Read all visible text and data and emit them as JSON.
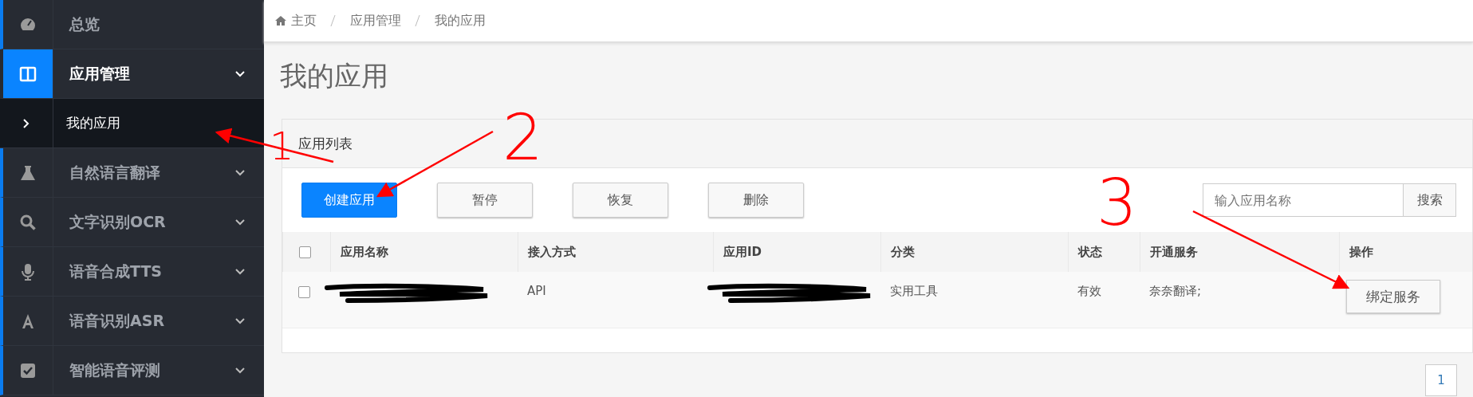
{
  "sidebar": {
    "items": [
      {
        "label": "总览",
        "selected": false,
        "has_caret": false
      },
      {
        "label": "应用管理",
        "selected": true,
        "has_caret": true,
        "expanded": true,
        "children": [
          {
            "label": "我的应用",
            "selected": true
          }
        ]
      },
      {
        "label": "自然语言翻译",
        "selected": false,
        "has_caret": true
      },
      {
        "label": "文字识别OCR",
        "selected": false,
        "has_caret": true
      },
      {
        "label": "语音合成TTS",
        "selected": false,
        "has_caret": true
      },
      {
        "label": "语音识别ASR",
        "selected": false,
        "has_caret": true
      },
      {
        "label": "智能语音评测",
        "selected": false,
        "has_caret": true
      }
    ]
  },
  "breadcrumb": [
    "主页",
    "应用管理",
    "我的应用"
  ],
  "page_title": "我的应用",
  "panel": {
    "title": "应用列表",
    "toolbar": [
      {
        "label": "创建应用",
        "kind": "primary"
      },
      {
        "label": "暂停",
        "kind": "default"
      },
      {
        "label": "恢复",
        "kind": "default"
      },
      {
        "label": "删除",
        "kind": "default"
      }
    ],
    "search": {
      "placeholder": "输入应用名称",
      "button": "搜索"
    },
    "table": {
      "columns": [
        "应用名称",
        "接入方式",
        "应用ID",
        "分类",
        "状态",
        "开通服务",
        "操作"
      ],
      "header_checked": false,
      "rows": [
        {
          "checked": false,
          "cells": [
            {
              "kind": "redacted"
            },
            {
              "kind": "text",
              "text": "API"
            },
            {
              "kind": "redacted"
            },
            {
              "kind": "text",
              "text": "实用工具"
            },
            {
              "kind": "text",
              "text": "有效"
            },
            {
              "kind": "text",
              "text": "奈奈翻译;"
            },
            {
              "kind": "button",
              "text": "绑定服务"
            }
          ]
        }
      ]
    }
  },
  "pagination": [
    "1"
  ],
  "annotations": [
    {
      "label": "1"
    },
    {
      "label": "2"
    },
    {
      "label": "3"
    }
  ]
}
